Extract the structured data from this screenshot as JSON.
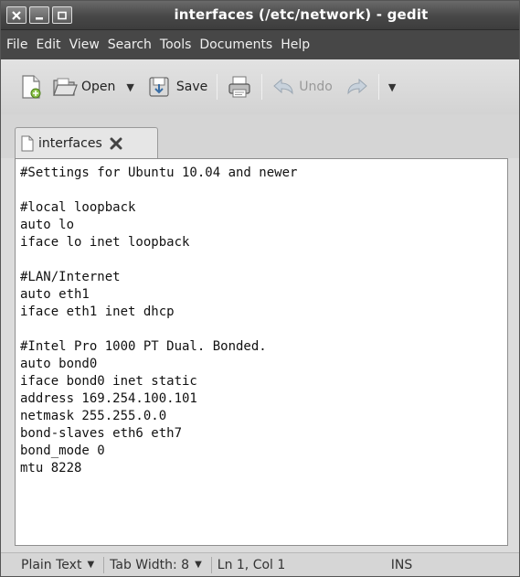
{
  "window": {
    "title": "interfaces (/etc/network) - gedit"
  },
  "menubar": {
    "items": [
      "File",
      "Edit",
      "View",
      "Search",
      "Tools",
      "Documents",
      "Help"
    ]
  },
  "toolbar": {
    "open_label": "Open",
    "save_label": "Save",
    "undo_label": "Undo"
  },
  "tab": {
    "label": "interfaces"
  },
  "editor": {
    "lines": [
      "#Settings for Ubuntu 10.04 and newer",
      "",
      "#local loopback",
      "auto lo",
      "iface lo inet loopback",
      "",
      "#LAN/Internet",
      "auto eth1",
      "iface eth1 inet dhcp",
      "",
      "#Intel Pro 1000 PT Dual. Bonded.",
      "auto bond0",
      "iface bond0 inet static",
      "address 169.254.100.101",
      "netmask 255.255.0.0",
      "bond-slaves eth6 eth7",
      "bond_mode 0",
      "mtu 8228"
    ]
  },
  "statusbar": {
    "language": "Plain Text",
    "tab_width": "Tab Width: 8",
    "position": "Ln 1, Col 1",
    "mode": "INS"
  }
}
